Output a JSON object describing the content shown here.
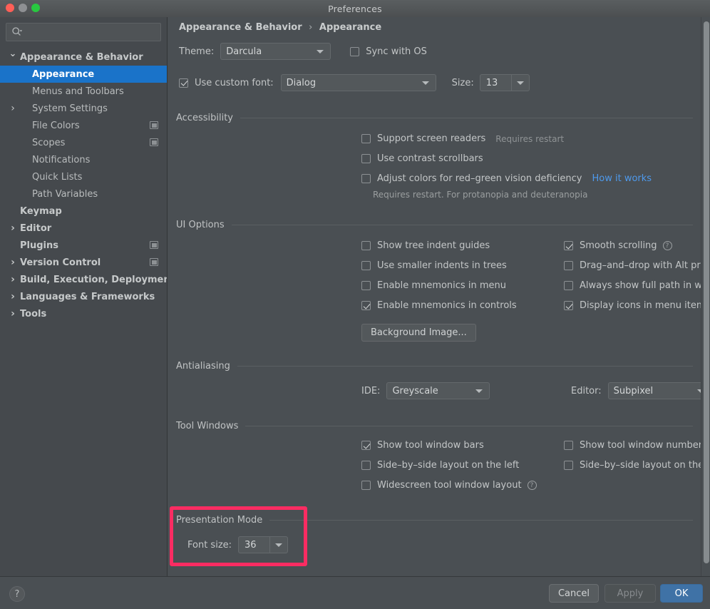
{
  "window": {
    "title": "Preferences",
    "traffic_lights": [
      "close",
      "minimize",
      "zoom"
    ]
  },
  "sidebar": {
    "search": {
      "placeholder": "",
      "value": "",
      "icon": "search-icon"
    },
    "items": [
      {
        "label": "Appearance & Behavior",
        "level": 0,
        "twisty": "expanded",
        "bold": true,
        "selected": false,
        "badge": false
      },
      {
        "label": "Appearance",
        "level": 1,
        "twisty": "none",
        "bold": true,
        "selected": true,
        "badge": false
      },
      {
        "label": "Menus and Toolbars",
        "level": 1,
        "twisty": "none",
        "bold": false,
        "selected": false,
        "badge": false
      },
      {
        "label": "System Settings",
        "level": 1,
        "twisty": "collapsed",
        "bold": false,
        "selected": false,
        "badge": false
      },
      {
        "label": "File Colors",
        "level": 1,
        "twisty": "none",
        "bold": false,
        "selected": false,
        "badge": true
      },
      {
        "label": "Scopes",
        "level": 1,
        "twisty": "none",
        "bold": false,
        "selected": false,
        "badge": true
      },
      {
        "label": "Notifications",
        "level": 1,
        "twisty": "none",
        "bold": false,
        "selected": false,
        "badge": false
      },
      {
        "label": "Quick Lists",
        "level": 1,
        "twisty": "none",
        "bold": false,
        "selected": false,
        "badge": false
      },
      {
        "label": "Path Variables",
        "level": 1,
        "twisty": "none",
        "bold": false,
        "selected": false,
        "badge": false
      },
      {
        "label": "Keymap",
        "level": 0,
        "twisty": "none",
        "bold": true,
        "selected": false,
        "badge": false
      },
      {
        "label": "Editor",
        "level": 0,
        "twisty": "collapsed",
        "bold": true,
        "selected": false,
        "badge": false
      },
      {
        "label": "Plugins",
        "level": 0,
        "twisty": "none",
        "bold": true,
        "selected": false,
        "badge": true
      },
      {
        "label": "Version Control",
        "level": 0,
        "twisty": "collapsed",
        "bold": true,
        "selected": false,
        "badge": true
      },
      {
        "label": "Build, Execution, Deployment",
        "level": 0,
        "twisty": "collapsed",
        "bold": true,
        "selected": false,
        "badge": false
      },
      {
        "label": "Languages & Frameworks",
        "level": 0,
        "twisty": "collapsed",
        "bold": true,
        "selected": false,
        "badge": false
      },
      {
        "label": "Tools",
        "level": 0,
        "twisty": "collapsed",
        "bold": true,
        "selected": false,
        "badge": false
      }
    ]
  },
  "main": {
    "breadcrumb": {
      "parent": "Appearance & Behavior",
      "separator": "›",
      "current": "Appearance"
    },
    "theme": {
      "label": "Theme:",
      "value": "Darcula",
      "sync_label": "Sync with OS",
      "sync_checked": false
    },
    "font": {
      "custom_label": "Use custom font:",
      "custom_checked": true,
      "family": "Dialog",
      "size_label": "Size:",
      "size_value": "13"
    },
    "accessibility": {
      "title": "Accessibility",
      "options": [
        {
          "label": "Support screen readers",
          "checked": false,
          "hint": "Requires restart",
          "link": ""
        },
        {
          "label": "Use contrast scrollbars",
          "checked": false,
          "hint": "",
          "link": ""
        },
        {
          "label": "Adjust colors for red–green vision deficiency",
          "checked": false,
          "hint": "",
          "link": "How it works"
        }
      ],
      "footnote": "Requires restart. For protanopia and deuteranopia"
    },
    "ui_options": {
      "title": "UI Options",
      "left": [
        {
          "label": "Show tree indent guides",
          "checked": false,
          "help": false
        },
        {
          "label": "Use smaller indents in trees",
          "checked": false,
          "help": false
        },
        {
          "label": "Enable mnemonics in menu",
          "checked": false,
          "help": false
        },
        {
          "label": "Enable mnemonics in controls",
          "checked": true,
          "help": false
        }
      ],
      "right": [
        {
          "label": "Smooth scrolling",
          "checked": true,
          "help": true
        },
        {
          "label": "Drag–and–drop with Alt pressed only",
          "checked": false,
          "help": false
        },
        {
          "label": "Always show full path in window header",
          "checked": false,
          "help": false
        },
        {
          "label": "Display icons in menu items",
          "checked": true,
          "help": false
        }
      ],
      "background_image_button": "Background Image..."
    },
    "antialiasing": {
      "title": "Antialiasing",
      "ide_label": "IDE:",
      "ide_value": "Greyscale",
      "editor_label": "Editor:",
      "editor_value": "Subpixel"
    },
    "tool_windows": {
      "title": "Tool Windows",
      "left": [
        {
          "label": "Show tool window bars",
          "checked": true,
          "help": false
        },
        {
          "label": "Side–by–side layout on the left",
          "checked": false,
          "help": false
        },
        {
          "label": "Widescreen tool window layout",
          "checked": false,
          "help": true
        }
      ],
      "right": [
        {
          "label": "Show tool window numbers",
          "checked": false,
          "help": false
        },
        {
          "label": "Side–by–side layout on the right",
          "checked": false,
          "help": false
        }
      ]
    },
    "presentation_mode": {
      "title": "Presentation Mode",
      "font_size_label": "Font size:",
      "font_size_value": "36",
      "highlight_color": "#fb2c62"
    }
  },
  "footer": {
    "help_label": "?",
    "cancel_label": "Cancel",
    "apply_label": "Apply",
    "ok_label": "OK"
  },
  "colors": {
    "window_bg": "#4a4f53",
    "sidebar_bg": "#45494d",
    "selection_blue": "#1a73c9",
    "link_blue": "#4e9aec",
    "ok_blue": "#3f72a6",
    "highlight_pink": "#fb2c62"
  }
}
